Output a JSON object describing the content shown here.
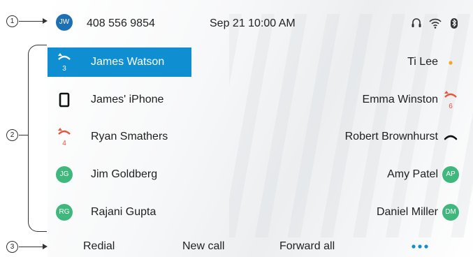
{
  "callouts": {
    "one": "1",
    "two": "2",
    "three": "3"
  },
  "header": {
    "avatar_initials": "JW",
    "phone_number": "408 556 9854",
    "datetime": "Sep 21 10:00 AM",
    "icons": [
      "headset-icon",
      "wifi-icon",
      "bluetooth-icon"
    ],
    "avatar_color": "#1e6fb3"
  },
  "lines": [
    {
      "label": "James Watson",
      "icon": "call-forward-icon",
      "badge": "3",
      "selected": true
    },
    {
      "label": "James' iPhone",
      "icon": "mobile-phone-icon"
    },
    {
      "label": "Ryan Smathers",
      "icon": "call-forward-icon",
      "badge": "4"
    },
    {
      "label": "Jim Goldberg",
      "icon": "avatar",
      "initials": "JG"
    },
    {
      "label": "Rajani Gupta",
      "icon": "avatar",
      "initials": "RG"
    }
  ],
  "speed_dials": [
    {
      "label": "Ti Lee",
      "icon": "presence-dot-icon"
    },
    {
      "label": "Emma Winston",
      "icon": "call-forward-icon",
      "badge": "6"
    },
    {
      "label": "Robert Brownhurst",
      "icon": "handset-icon"
    },
    {
      "label": "Amy Patel",
      "icon": "avatar",
      "initials": "AP"
    },
    {
      "label": "Daniel Miller",
      "icon": "avatar",
      "initials": "DM"
    }
  ],
  "softkeys": {
    "redial": "Redial",
    "new_call": "New call",
    "forward_all": "Forward all",
    "more_icon": "more-dots-icon"
  },
  "colors": {
    "selection": "#0f8fd1",
    "avatar_green": "#3fb77d",
    "alert_red": "#e8533c",
    "presence_orange": "#f5a623"
  }
}
